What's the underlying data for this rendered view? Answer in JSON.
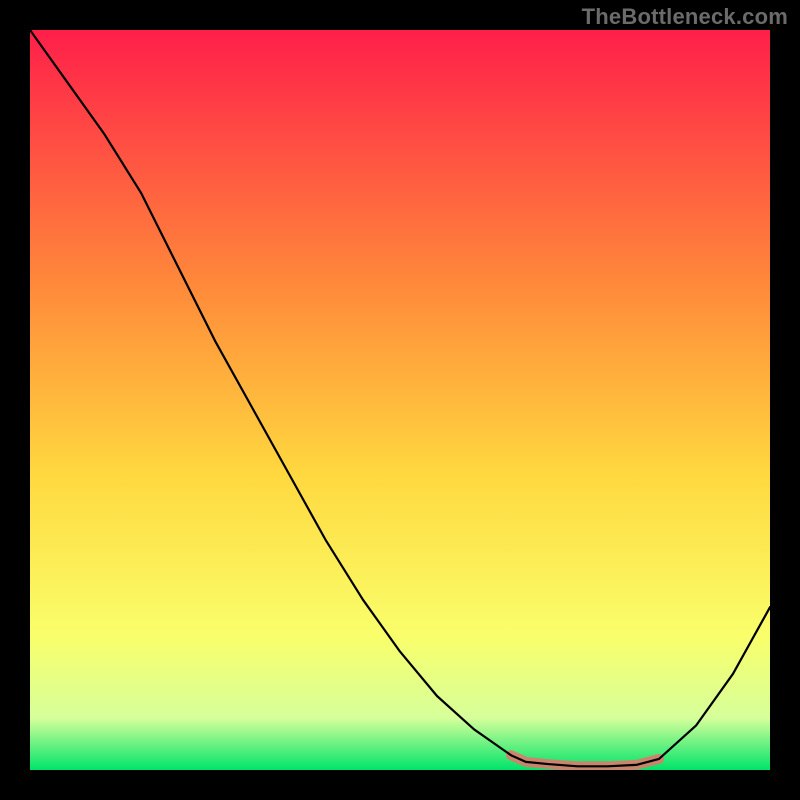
{
  "watermark": "TheBottleneck.com",
  "colors": {
    "black": "#000000",
    "watermark_text": "#6b6b6b",
    "gradient_top": "#ff1f4a",
    "gradient_upper_mid": "#ff8b3a",
    "gradient_mid": "#ffd83f",
    "gradient_lower_mid": "#f9ff6b",
    "gradient_near_bottom": "#d6ff9a",
    "gradient_bottom": "#00e46a",
    "curve_stroke": "#000000",
    "highlight_stroke": "#e8736c"
  },
  "chart_data": {
    "type": "line",
    "title": "",
    "xlabel": "",
    "ylabel": "",
    "xlim": [
      0,
      100
    ],
    "ylim": [
      0,
      100
    ],
    "x": [
      0,
      5,
      10,
      15,
      20,
      25,
      30,
      35,
      40,
      45,
      50,
      55,
      60,
      65,
      67,
      70,
      74,
      78,
      82,
      85,
      90,
      95,
      100
    ],
    "curve_y": [
      100,
      93,
      86,
      78,
      68,
      58,
      49,
      40,
      31,
      23,
      16,
      10,
      5.5,
      2.0,
      1.1,
      0.8,
      0.5,
      0.5,
      0.7,
      1.5,
      6,
      13,
      22
    ],
    "optimal_band": {
      "x": [
        65,
        67,
        70,
        74,
        78,
        82,
        85
      ],
      "y": [
        2.0,
        1.1,
        0.8,
        0.5,
        0.5,
        0.7,
        1.5
      ]
    },
    "annotations": []
  }
}
